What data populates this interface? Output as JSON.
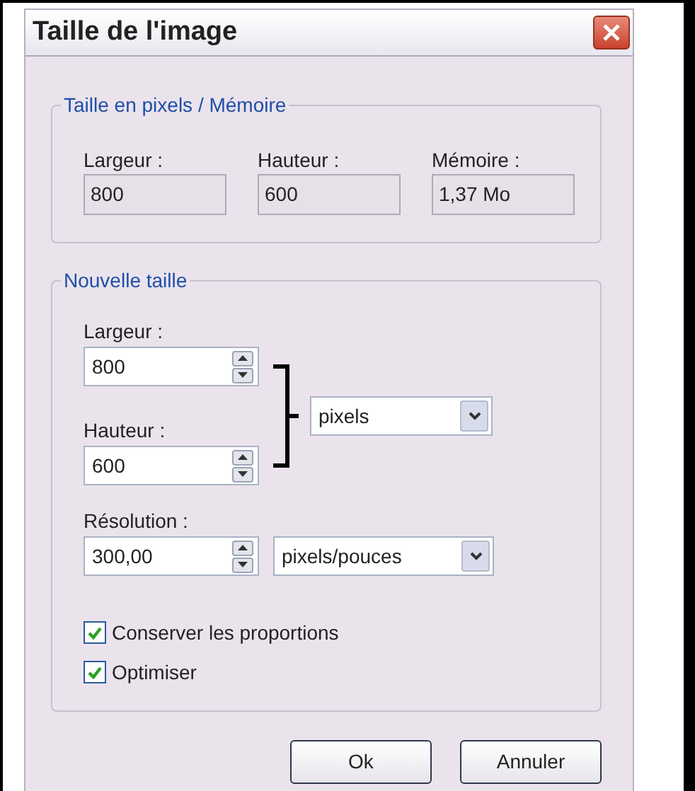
{
  "window": {
    "title": "Taille de l'image"
  },
  "pixel_memory": {
    "title": "Taille en pixels / Mémoire",
    "fields": [
      {
        "label": "Largeur :",
        "value": "800"
      },
      {
        "label": "Hauteur :",
        "value": "600"
      },
      {
        "label": "Mémoire :",
        "value": "1,37 Mo"
      }
    ]
  },
  "new_size": {
    "title": "Nouvelle taille",
    "width": {
      "label": "Largeur :",
      "value": "800"
    },
    "height": {
      "label": "Hauteur :",
      "value": "600"
    },
    "unit": {
      "value": "pixels"
    },
    "resolution": {
      "label": "Résolution :",
      "value": "300,00",
      "unit": "pixels/pouces"
    },
    "checkboxes": [
      {
        "label": "Conserver les proportions",
        "checked": true
      },
      {
        "label": "Optimiser",
        "checked": true
      }
    ]
  },
  "buttons": [
    "Ok",
    "Annuler"
  ]
}
